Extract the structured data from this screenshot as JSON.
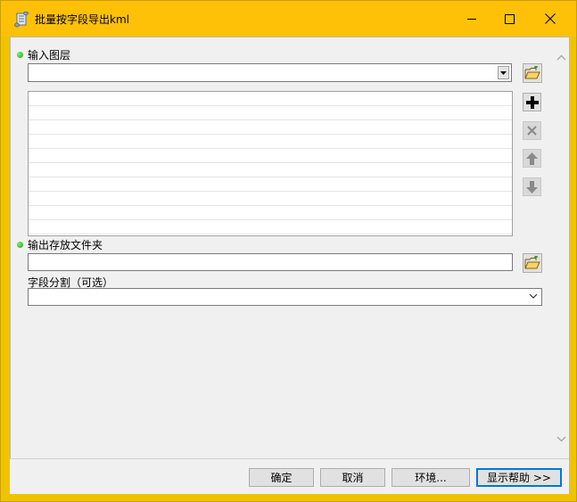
{
  "window": {
    "title": "批量按字段导出kml",
    "controls": {
      "minimize": "minimize",
      "maximize": "maximize",
      "close": "close"
    }
  },
  "form": {
    "input_layer": {
      "label": "输入图层",
      "value": "",
      "required": true
    },
    "layer_list": {
      "rows": []
    },
    "list_tools": [
      {
        "name": "add",
        "icon": "plus-icon",
        "enabled": true
      },
      {
        "name": "remove",
        "icon": "x-icon",
        "enabled": false
      },
      {
        "name": "move-up",
        "icon": "arrow-up-icon",
        "enabled": false
      },
      {
        "name": "move-down",
        "icon": "arrow-down-icon",
        "enabled": false
      }
    ],
    "output_folder": {
      "label": "输出存放文件夹",
      "value": "",
      "required": true
    },
    "field_split": {
      "label": "字段分割（可选）",
      "value": ""
    }
  },
  "buttons": {
    "ok": "确定",
    "cancel": "取消",
    "environments": "环境...",
    "show_help": "显示帮助 >>"
  },
  "colors": {
    "titlebar": "#ffc107",
    "required_dot": "#22b51a",
    "default_button_border": "#0078d7"
  }
}
